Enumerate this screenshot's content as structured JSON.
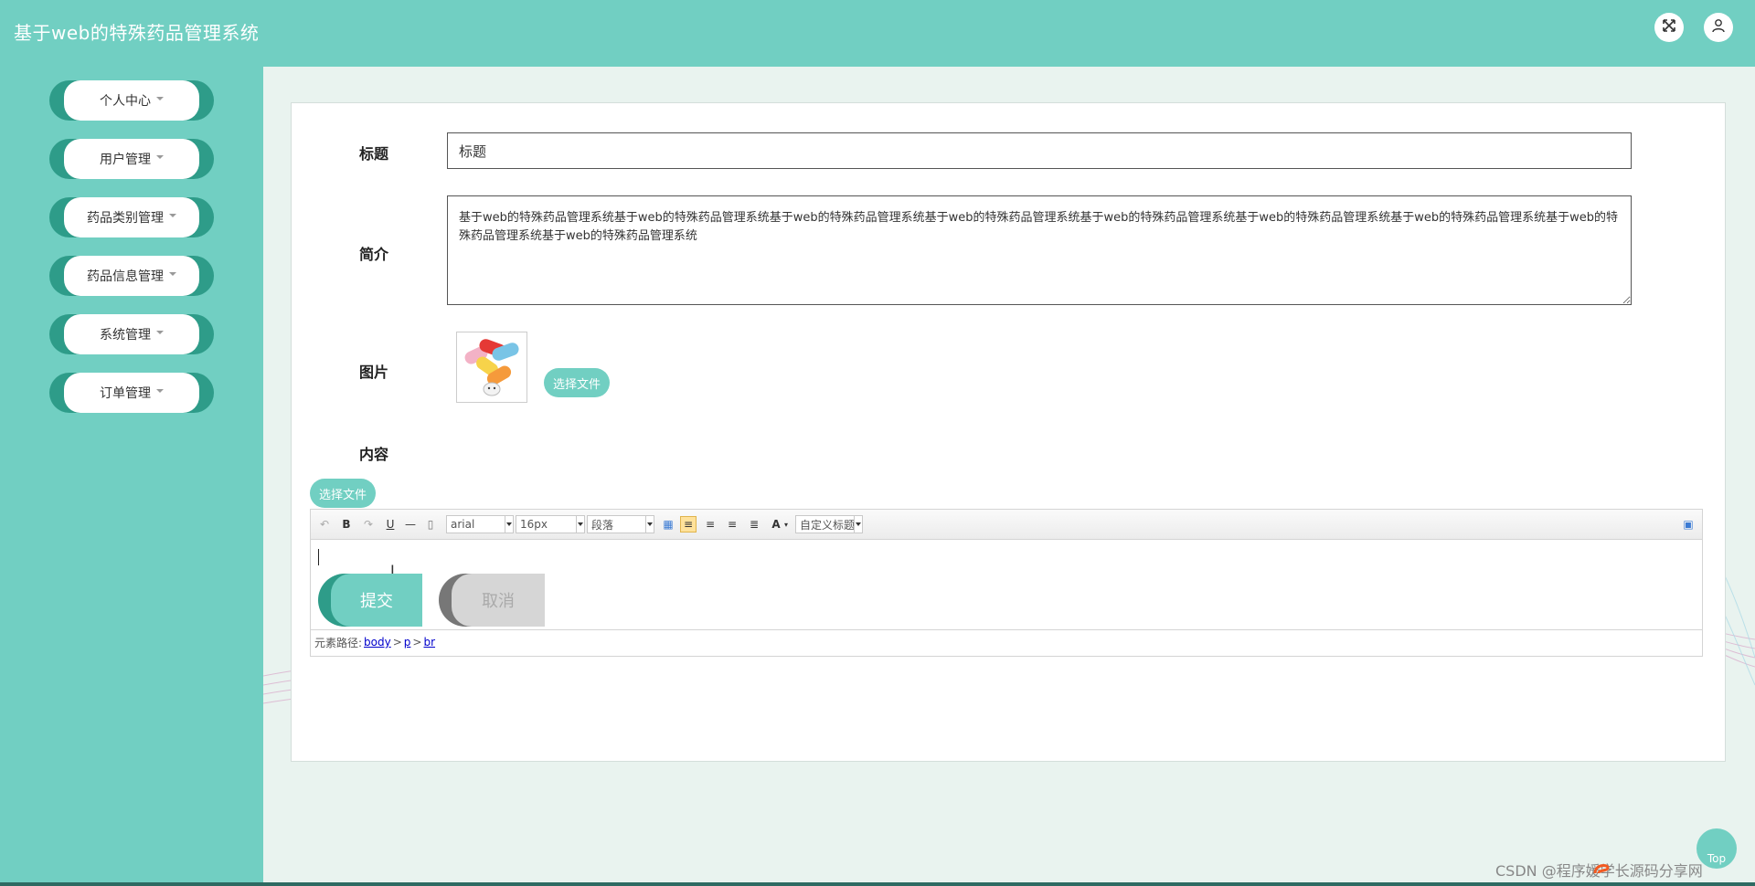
{
  "header": {
    "title": "基于web的特殊药品管理系统"
  },
  "sidebar": {
    "items": [
      {
        "label": "个人中心"
      },
      {
        "label": "用户管理"
      },
      {
        "label": "药品类别管理"
      },
      {
        "label": "药品信息管理"
      },
      {
        "label": "系统管理"
      },
      {
        "label": "订单管理"
      }
    ]
  },
  "form": {
    "title_label": "标题",
    "title_value": "标题",
    "intro_label": "简介",
    "intro_value": "基于web的特殊药品管理系统基于web的特殊药品管理系统基于web的特殊药品管理系统基于web的特殊药品管理系统基于web的特殊药品管理系统基于web的特殊药品管理系统基于web的特殊药品管理系统基于web的特殊药品管理系统基于web的特殊药品管理系统",
    "image_label": "图片",
    "image_choose_file": "选择文件",
    "content_label": "内容",
    "content_choose_file": "选择文件",
    "submit_label": "提交",
    "cancel_label": "取消"
  },
  "editor": {
    "font_family": "arial",
    "font_size": "16px",
    "paragraph": "段落",
    "custom_heading": "自定义标题",
    "path_label": "元素路径:",
    "path": [
      "body",
      "p",
      "br"
    ]
  },
  "footer": {
    "top_label": "Top",
    "watermark": "CSDN @程序媛学长源码分享网"
  },
  "colors": {
    "accent": "#71cfc2",
    "accent_dark": "#2e9c89"
  }
}
